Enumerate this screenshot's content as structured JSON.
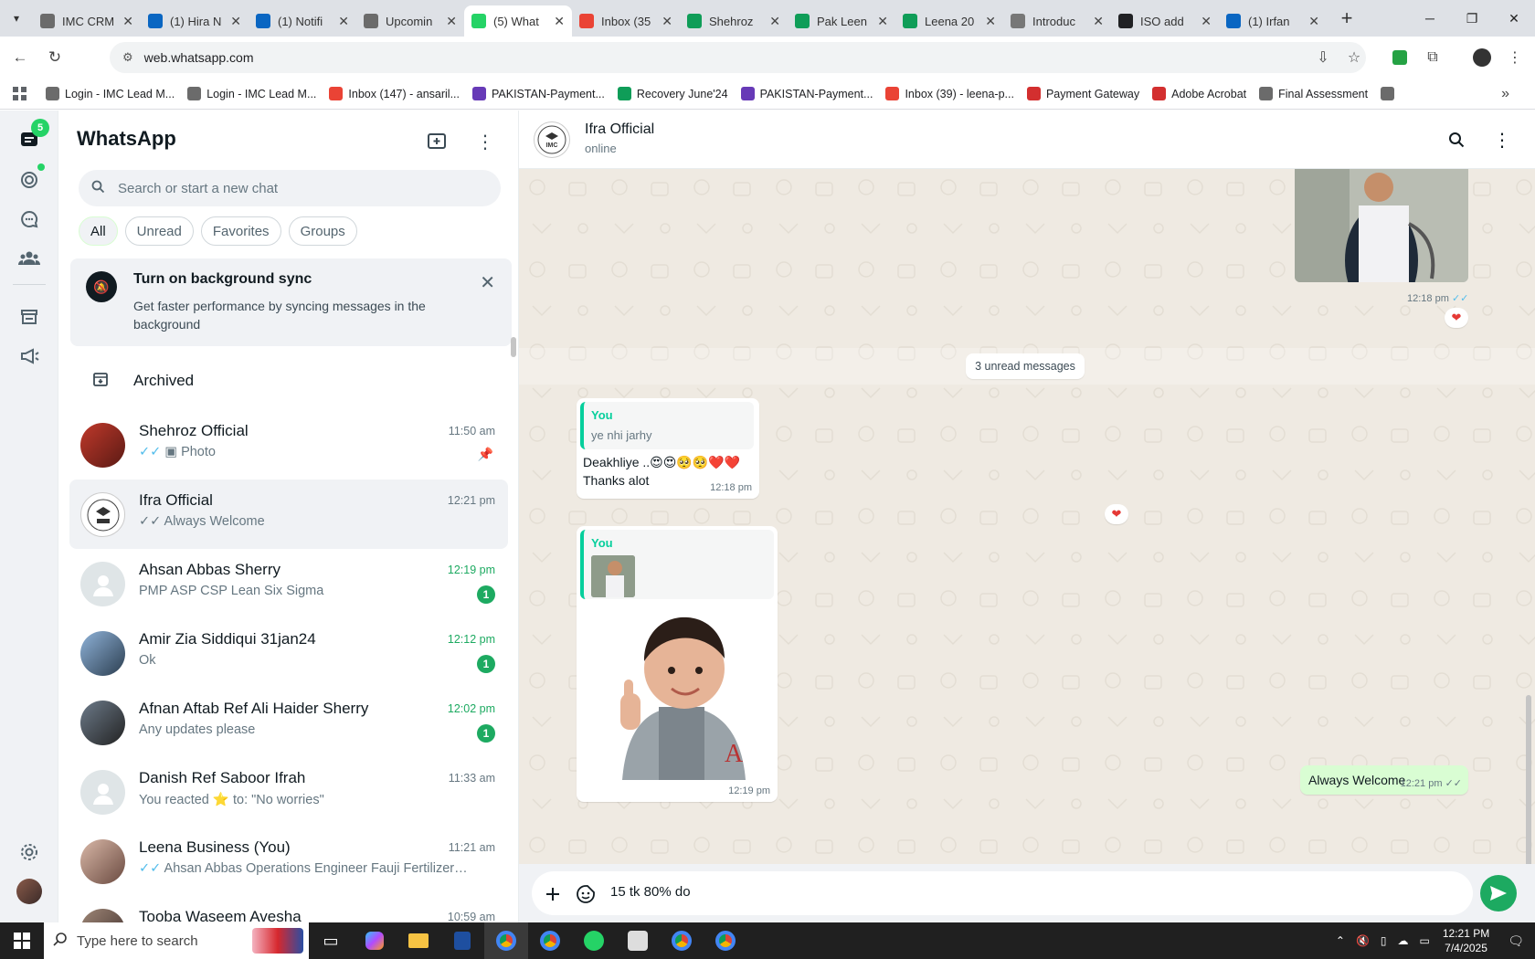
{
  "browser": {
    "tabs": [
      {
        "title": "IMC CRM",
        "icon": "imc-logo-icon",
        "color": "#6b6b6b"
      },
      {
        "title": "(1) Hira N",
        "icon": "linkedin-icon",
        "color": "#0a66c2"
      },
      {
        "title": "(1) Notifi",
        "icon": "linkedin-icon",
        "color": "#0a66c2"
      },
      {
        "title": "Upcomin",
        "icon": "imc-logo-icon",
        "color": "#6b6b6b"
      },
      {
        "title": "(5) What",
        "icon": "whatsapp-icon",
        "color": "#25d366",
        "active": true
      },
      {
        "title": "Inbox (35",
        "icon": "gmail-icon",
        "color": "#ea4335"
      },
      {
        "title": "Shehroz",
        "icon": "sheets-icon",
        "color": "#0f9d58"
      },
      {
        "title": "Pak Leen",
        "icon": "sheets-icon",
        "color": "#0f9d58"
      },
      {
        "title": "Leena 20",
        "icon": "sheets-icon",
        "color": "#0f9d58"
      },
      {
        "title": "Introduc",
        "icon": "globe-icon",
        "color": "#777777"
      },
      {
        "title": "ISO add",
        "icon": "openai-icon",
        "color": "#202124"
      },
      {
        "title": "(1) Irfan",
        "icon": "linkedin-icon",
        "color": "#0a66c2"
      }
    ],
    "url": "web.whatsapp.com",
    "bookmarks": [
      {
        "label": "Login - IMC Lead M...",
        "icon": "imc-logo-icon",
        "color": "#6b6b6b"
      },
      {
        "label": "Login - IMC Lead M...",
        "icon": "imc-logo-icon",
        "color": "#6b6b6b"
      },
      {
        "label": "Inbox (147) - ansaril...",
        "icon": "gmail-icon",
        "color": "#ea4335"
      },
      {
        "label": "PAKISTAN-Payment...",
        "icon": "forms-icon",
        "color": "#673ab7"
      },
      {
        "label": "Recovery June'24",
        "icon": "sheets-icon",
        "color": "#0f9d58"
      },
      {
        "label": "PAKISTAN-Payment...",
        "icon": "forms-icon",
        "color": "#673ab7"
      },
      {
        "label": "Inbox (39) - leena-p...",
        "icon": "gmail-icon",
        "color": "#ea4335"
      },
      {
        "label": "Payment Gateway",
        "icon": "acrobat-icon",
        "color": "#d32f2f"
      },
      {
        "label": "Adobe Acrobat",
        "icon": "acrobat-icon",
        "color": "#d32f2f"
      },
      {
        "label": "Final Assessment",
        "icon": "imc-logo-icon",
        "color": "#6b6b6b"
      }
    ]
  },
  "rail": {
    "chats_badge": "5"
  },
  "sidebar": {
    "title": "WhatsApp",
    "search_placeholder": "Search or start a new chat",
    "filters": [
      "All",
      "Unread",
      "Favorites",
      "Groups"
    ],
    "sync_banner": {
      "title": "Turn on background sync",
      "desc": "Get faster performance by syncing messages in the background"
    },
    "archived_label": "Archived",
    "chats": [
      {
        "name": "Shehroz Official",
        "time": "11:50 am",
        "preview": "Photo",
        "tick": "blue",
        "photo_icon": true,
        "pinned": true,
        "avatar": "photo"
      },
      {
        "name": "Ifra Official",
        "time": "12:21 pm",
        "preview": "Always Welcome",
        "tick": "grey",
        "selected": true,
        "avatar": "logo"
      },
      {
        "name": "Ahsan Abbas Sherry",
        "time": "12:19 pm",
        "preview": "PMP ASP CSP Lean Six Sigma",
        "unread": "1",
        "avatar": "default"
      },
      {
        "name": "Amir Zia Siddiqui 31jan24",
        "time": "12:12 pm",
        "preview": "Ok",
        "unread": "1",
        "avatar": "photo"
      },
      {
        "name": "Afnan Aftab Ref Ali Haider Sherry",
        "time": "12:02 pm",
        "preview": "Any updates please",
        "unread": "1",
        "avatar": "photo"
      },
      {
        "name": "Danish Ref Saboor Ifrah",
        "time": "11:33 am",
        "preview": "You reacted ⭐ to: \"No worries\"",
        "avatar": "default"
      },
      {
        "name": "Leena Business (You)",
        "time": "11:21 am",
        "preview": "Ahsan Abbas Operations Engineer Fauji Fertilizer Comp...",
        "tick": "blue",
        "avatar": "photo"
      },
      {
        "name": "Tooba Waseem Avesha",
        "time": "10:59 am",
        "preview": "",
        "avatar": "photo"
      }
    ]
  },
  "conversation": {
    "name": "Ifra Official",
    "status": "online",
    "avatar_text": "IMC",
    "first_out_time": "12:18 pm",
    "unread_divider": "3 unread messages",
    "in_msg_1": {
      "quote_name": "You",
      "quote_text": "ye nhi jarhy",
      "line1": "Deakhliye ..😍😍🥺🥺❤️❤️",
      "line2": "Thanks alot",
      "time": "12:18 pm"
    },
    "in_msg_2": {
      "quote_name": "You",
      "time": "12:19 pm"
    },
    "out_msg": {
      "text": "Always Welcome",
      "time": "12:21 pm"
    },
    "composer_text": "15 tk 80% do"
  },
  "taskbar": {
    "search_placeholder": "Type here to search",
    "time": "12:21 PM",
    "date": "7/4/2025"
  }
}
